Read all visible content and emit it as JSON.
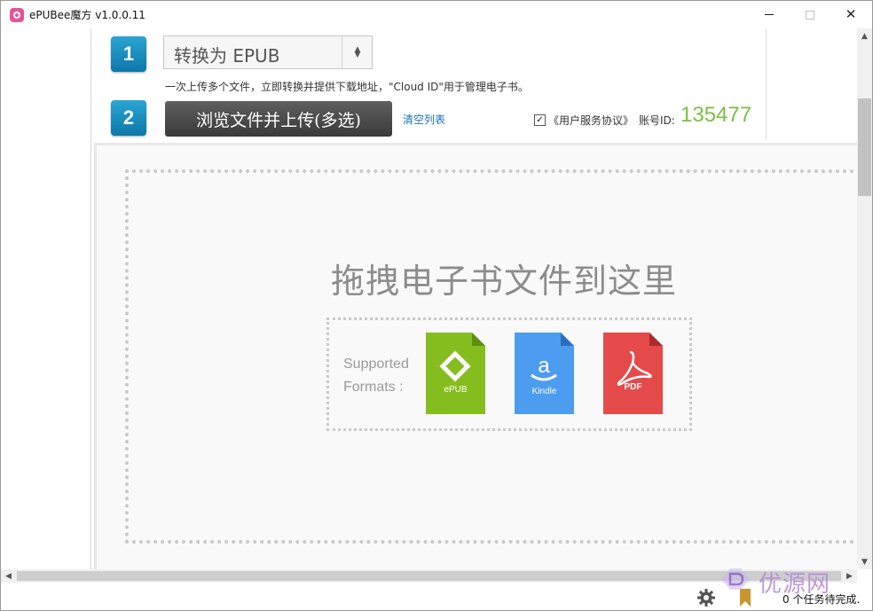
{
  "window": {
    "title": "ePUBee魔方 v1.0.0.11",
    "close_glyph": "✕"
  },
  "steps": {
    "step1_number": "1",
    "step2_number": "2"
  },
  "convert": {
    "selected_value": "转换为 EPUB",
    "hint": "一次上传多个文件，立即转换并提供下载地址，\"Cloud ID\"用于管理电子书。"
  },
  "upload": {
    "button_label": "浏览文件并上传(多选)",
    "clear_label": "清空列表",
    "agreement_label": "《用户服务协议》",
    "agreement_checked": true,
    "account_label": "账号ID:",
    "account_id": "135477"
  },
  "drop": {
    "title": "拖拽电子书文件到这里",
    "formats_line1": "Supported",
    "formats_line2": "Formats :",
    "formats": [
      {
        "name": "ePUB",
        "icon": "epub-icon",
        "color": "#86bd1e"
      },
      {
        "name": "Kindle",
        "icon": "amazon-kindle-icon",
        "color": "#4c9cf0"
      },
      {
        "name": "PDF",
        "icon": "acrobat-pdf-icon",
        "color": "#e44a4a"
      }
    ]
  },
  "status": {
    "text": "0 个任务待完成.",
    "icons": [
      "gear-icon",
      "bookmark-icon"
    ]
  },
  "watermark": {
    "text": "优源网"
  },
  "colors": {
    "accent_blue": "#1a8cc4",
    "account_green": "#7ac143",
    "link_blue": "#1a6fc0"
  }
}
